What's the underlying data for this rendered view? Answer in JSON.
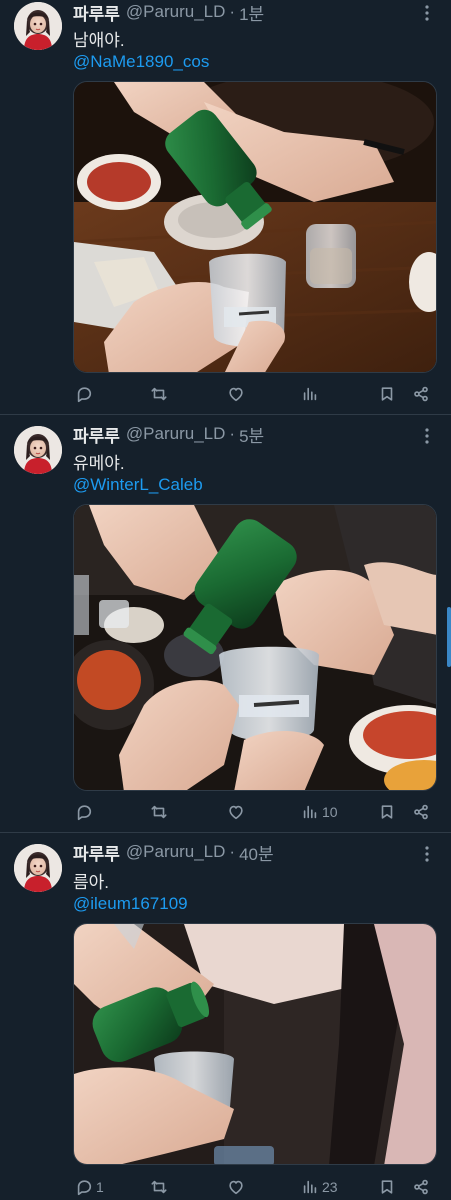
{
  "tweets": [
    {
      "display_name": "파루루",
      "handle": "@Paruru_LD",
      "separator": "·",
      "time": "1분",
      "text": "남애야.",
      "mention": "@NaMe1890_cos",
      "stats": {
        "reply": "",
        "retweet": "",
        "like": "",
        "views": ""
      }
    },
    {
      "display_name": "파루루",
      "handle": "@Paruru_LD",
      "separator": "·",
      "time": "5분",
      "text": "유메야.",
      "mention": "@WinterL_Caleb",
      "stats": {
        "reply": "",
        "retweet": "",
        "like": "",
        "views": "10"
      }
    },
    {
      "display_name": "파루루",
      "handle": "@Paruru_LD",
      "separator": "·",
      "time": "40분",
      "text": "름아.",
      "mention": "@ileum167109",
      "stats": {
        "reply": "1",
        "retweet": "",
        "like": "",
        "views": "23"
      }
    }
  ],
  "icons": {
    "more": "more-icon",
    "reply": "reply-icon",
    "retweet": "retweet-icon",
    "like": "heart-icon",
    "views": "views-icon",
    "bookmark": "bookmark-icon",
    "share": "share-icon"
  },
  "colors": {
    "background": "#15202b",
    "text_primary": "#e7e9ea",
    "text_secondary": "#8b98a5",
    "link": "#1d9bf0",
    "divider": "#2f3b47"
  }
}
